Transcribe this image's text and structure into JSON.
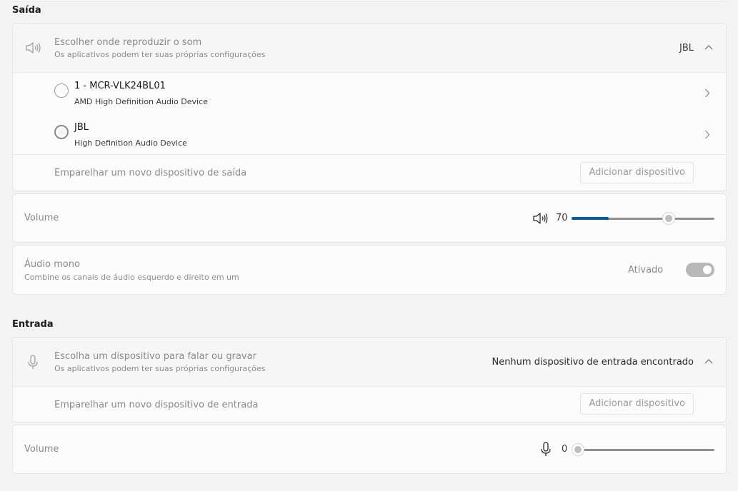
{
  "output": {
    "section_title": "Saída",
    "device_picker": {
      "title": "Escolher onde reproduzir o som",
      "subtitle": "Os aplicativos podem ter suas próprias configurações",
      "selected": "JBL",
      "icon": "speaker-icon"
    },
    "devices": [
      {
        "name": "1 - MCR-VLK24BL01",
        "description": "AMD High Definition Audio Device",
        "selected": false
      },
      {
        "name": "JBL",
        "description": "High Definition Audio Device",
        "selected": true
      }
    ],
    "pair": {
      "label": "Emparelhar um novo dispositivo de saída",
      "button": "Adicionar dispositivo"
    },
    "volume": {
      "label": "Volume",
      "value": "70",
      "level": 0.7,
      "icon": "speaker-icon"
    },
    "mono_audio": {
      "title": "Áudio mono",
      "subtitle": "Combine os canais de áudio esquerdo e direito em um",
      "state": "Ativado",
      "on": true
    }
  },
  "input": {
    "section_title": "Entrada",
    "device_picker": {
      "title": "Escolha um dispositivo para falar ou gravar",
      "subtitle": "Os aplicativos podem ter suas próprias configurações",
      "selected": "Nenhum dispositivo de entrada encontrado",
      "icon": "microphone-icon"
    },
    "pair": {
      "label": "Emparelhar um novo dispositivo de entrada",
      "button": "Adicionar dispositivo"
    },
    "volume": {
      "label": "Volume",
      "value": "0",
      "level": 0,
      "icon": "microphone-icon"
    }
  },
  "colors": {
    "accent": "#005a9e",
    "background": "#f3f3f3",
    "card": "#fbfbfb"
  }
}
